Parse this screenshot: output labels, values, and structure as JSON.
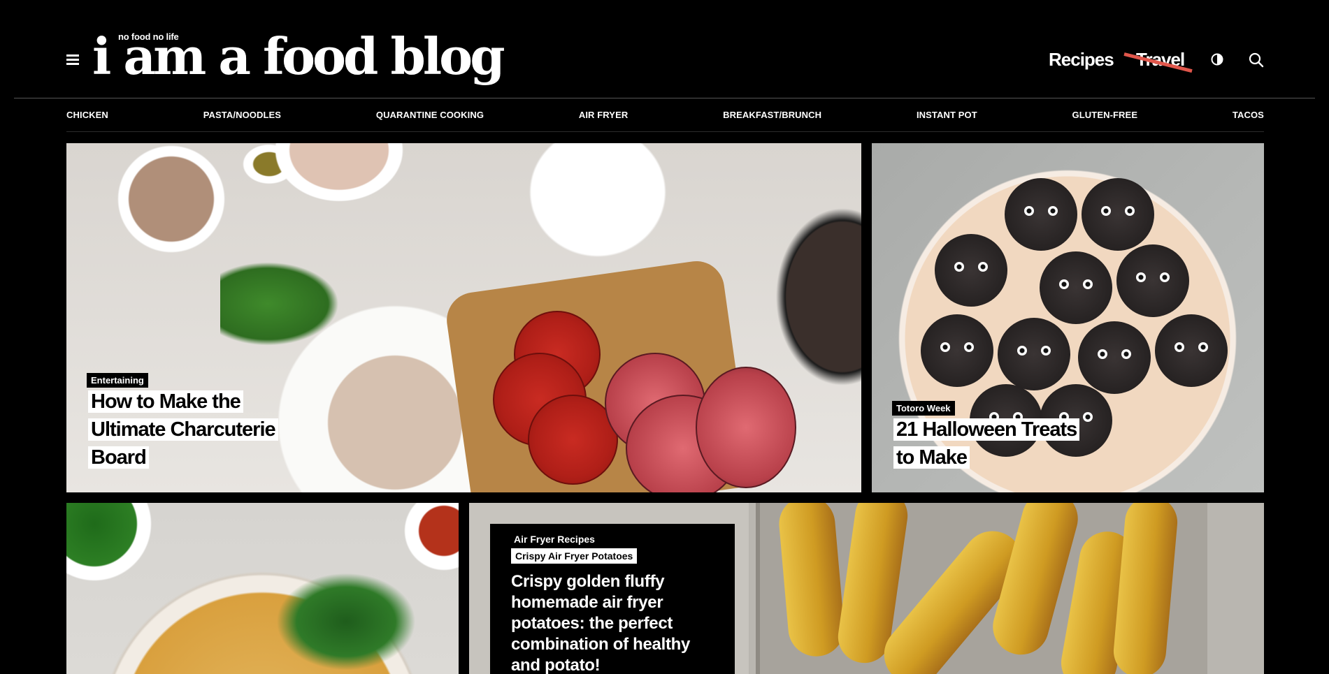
{
  "header": {
    "tagline": "no food no life",
    "logo": "i am a food blog",
    "nav": {
      "recipes": "Recipes",
      "travel": "Travel"
    },
    "icons": [
      "menu-icon",
      "contrast-icon",
      "search-icon"
    ]
  },
  "categories": [
    "CHICKEN",
    "PASTA/NOODLES",
    "QUARANTINE COOKING",
    "AIR FRYER",
    "BREAKFAST/BRUNCH",
    "INSTANT POT",
    "GLUTEN-FREE",
    "TACOS"
  ],
  "cards": {
    "main": {
      "tag": "Entertaining",
      "title_lines": [
        "How to Make the",
        "Ultimate Charcuterie",
        "Board"
      ]
    },
    "halloween": {
      "tag": "Totoro Week",
      "title_lines": [
        "21 Halloween Treats",
        "to Make"
      ]
    },
    "potatoes": {
      "category": "Air Fryer Recipes",
      "tag": "Crispy Air Fryer Potatoes",
      "text": "Crispy golden fluffy homemade air fryer potatoes: the perfect combination of healthy and potato!"
    }
  },
  "colors": {
    "background": "#000000",
    "text": "#ffffff",
    "strike": "#e0564b"
  }
}
